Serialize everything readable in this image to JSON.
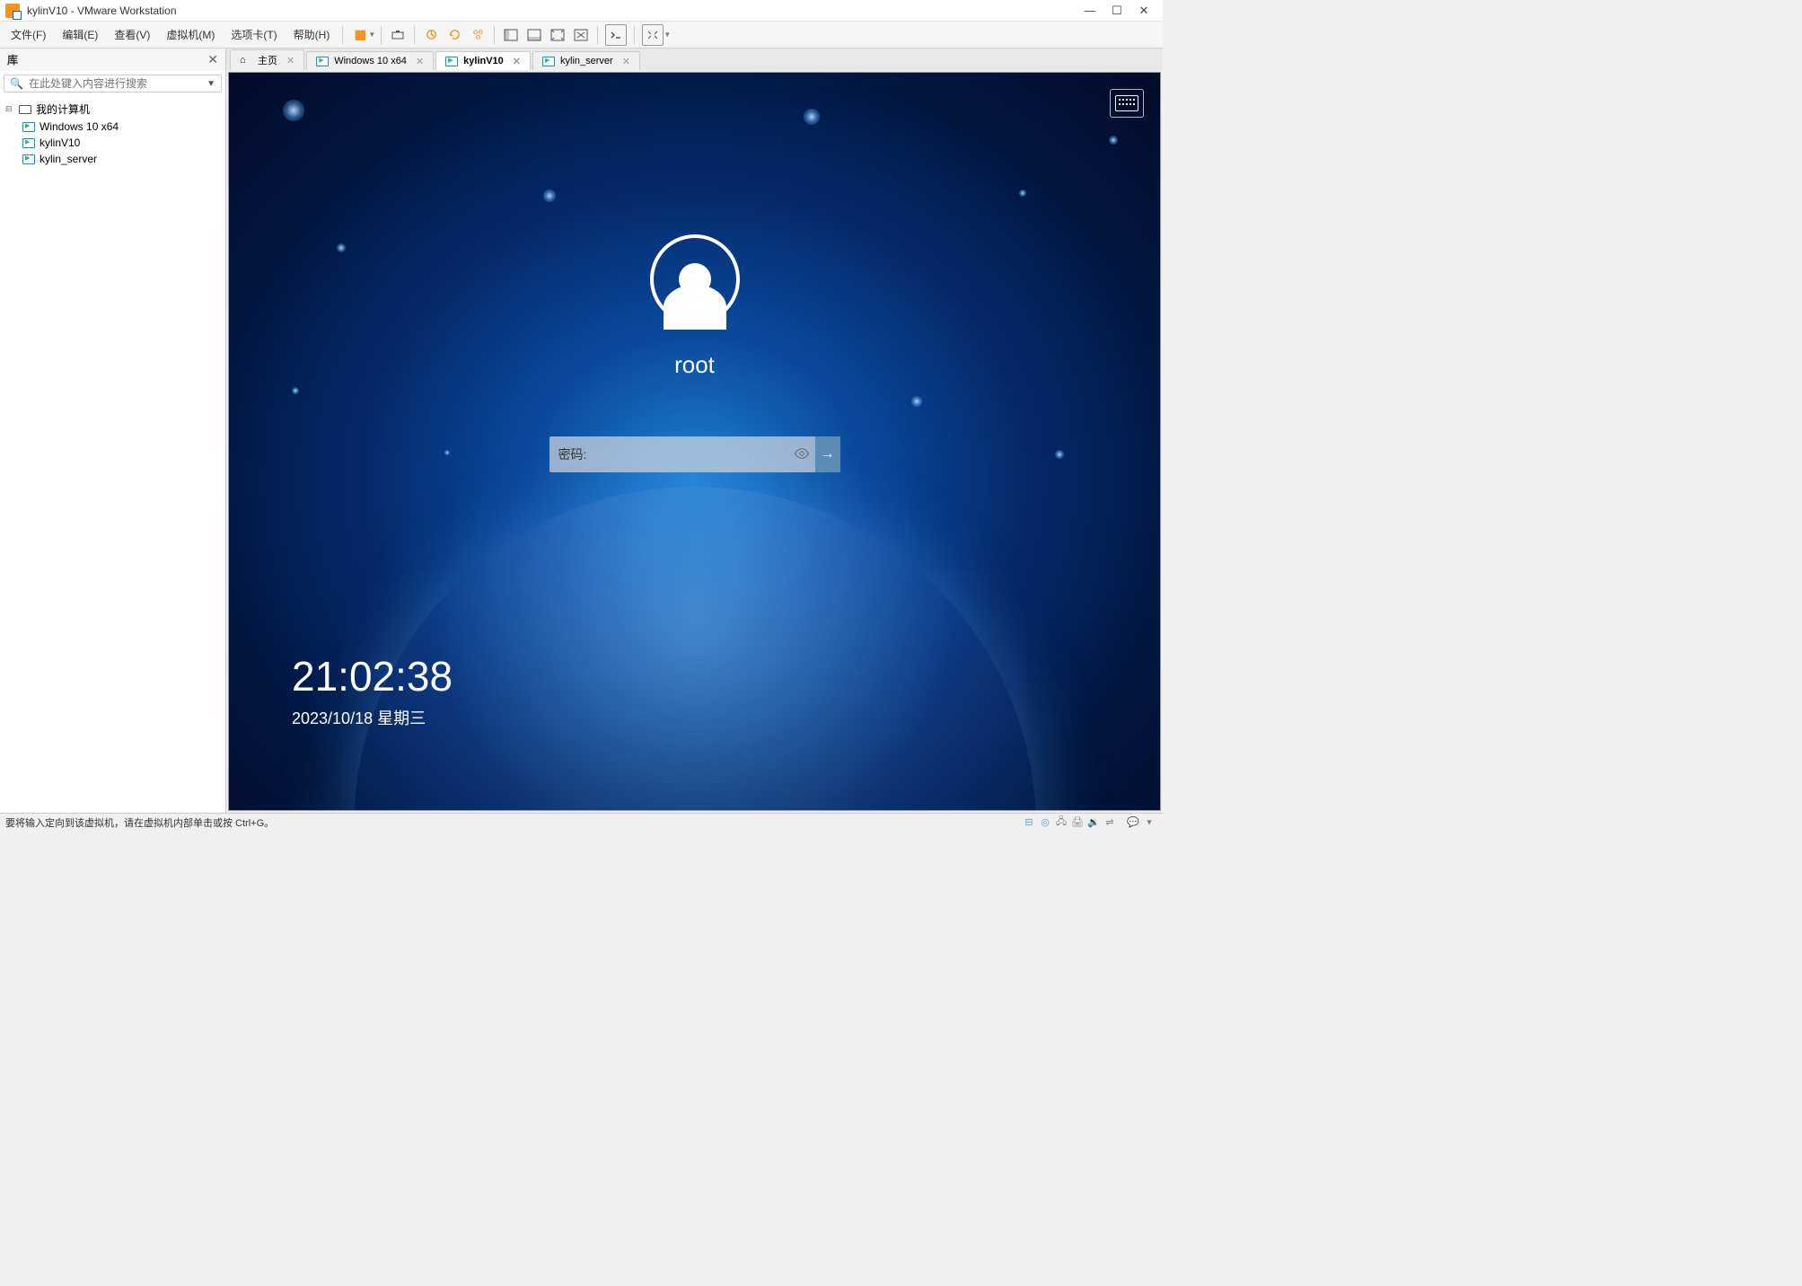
{
  "window": {
    "title": "kylinV10 - VMware Workstation",
    "buttons": {
      "min": "—",
      "max": "☐",
      "close": "✕"
    }
  },
  "menu": {
    "items": [
      "文件(F)",
      "编辑(E)",
      "查看(V)",
      "虚拟机(M)",
      "选项卡(T)",
      "帮助(H)"
    ]
  },
  "sidebar": {
    "title": "库",
    "search_placeholder": "在此处键入内容进行搜索",
    "root": "我的计算机",
    "vms": [
      "Windows 10 x64",
      "kylinV10",
      "kylin_server"
    ]
  },
  "tabs": [
    {
      "label": "主页",
      "icon": "home",
      "closable": true,
      "active": false
    },
    {
      "label": "Windows 10 x64",
      "icon": "vm",
      "closable": true,
      "active": false
    },
    {
      "label": "kylinV10",
      "icon": "vm",
      "closable": true,
      "active": true
    },
    {
      "label": "kylin_server",
      "icon": "vm",
      "closable": true,
      "active": false
    }
  ],
  "login": {
    "username": "root",
    "password_label": "密码:",
    "time": "21:02:38",
    "date": "2023/10/18 星期三"
  },
  "statusbar": {
    "hint": "要将输入定向到该虚拟机，请在虚拟机内部单击或按 Ctrl+G。"
  }
}
